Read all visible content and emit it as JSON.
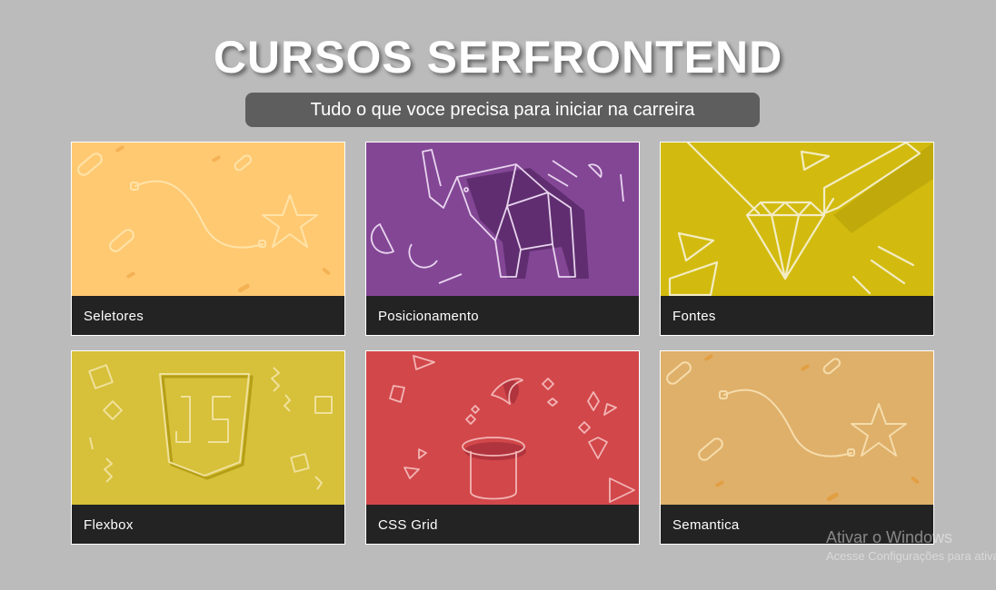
{
  "header": {
    "title": "CURSOS SERFRONTEND",
    "subtitle": "Tudo o que voce precisa para iniciar na carreira"
  },
  "courses": [
    {
      "label": "Seletores",
      "color": "#ffc972",
      "illustration": "star-path-icon"
    },
    {
      "label": "Posicionamento",
      "color": "#834695",
      "illustration": "origami-elephant-icon"
    },
    {
      "label": "Fontes",
      "color": "#d2bb0e",
      "illustration": "diamond-pencil-icon"
    },
    {
      "label": "Flexbox",
      "color": "#d7c03a",
      "illustration": "js-shield-icon"
    },
    {
      "label": "CSS Grid",
      "color": "#d2474a",
      "illustration": "magic-hat-icon"
    },
    {
      "label": "Semantica",
      "color": "#dfb06a",
      "illustration": "star-path-icon"
    }
  ],
  "watermark": {
    "line1": "Ativar o Windows",
    "line2": "Acesse Configurações para ativar o Windows."
  },
  "colors": {
    "background": "#bbbbbb",
    "subtitle_bg": "#5e5e5e",
    "card_footer": "#232323"
  }
}
